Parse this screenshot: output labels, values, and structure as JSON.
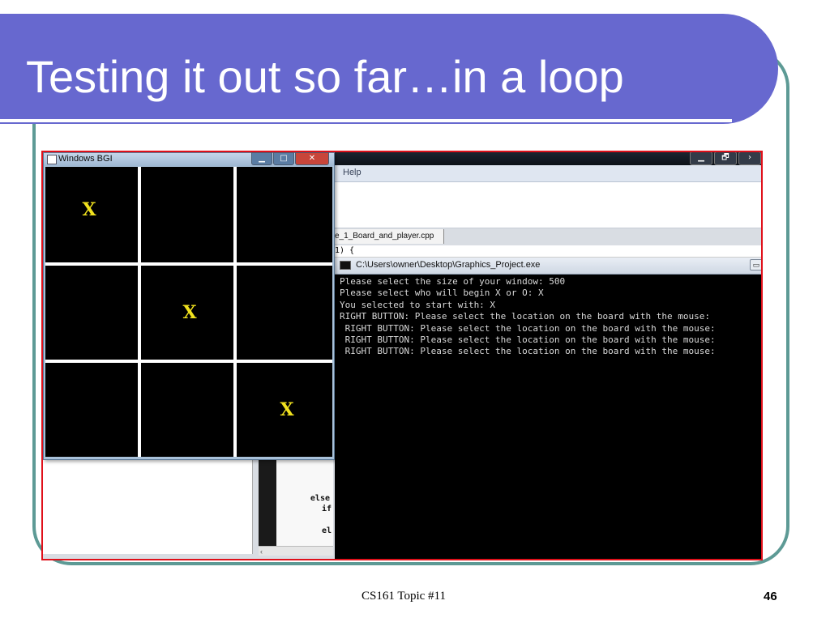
{
  "slide": {
    "title": "Testing it out so far…in a loop",
    "footer": "CS161 Topic #11",
    "page_number": "46"
  },
  "ide": {
    "menu_help": "Help",
    "tab_file": "e_1_Board_and_player.cpp",
    "code_top": "1)  {",
    "code_lines": [
      "else",
      "if",
      "el"
    ],
    "scroll_arrow": "‹",
    "window_controls": [
      "▁",
      "🗗",
      "›"
    ]
  },
  "console": {
    "title": "C:\\Users\\owner\\Desktop\\Graphics_Project.exe",
    "minimize": "▭",
    "lines": [
      "Please select the size of your window: 500",
      "Please select who will begin X or O: X",
      "You selected to start with: X",
      "RIGHT BUTTON: Please select the location on the board with the mouse:",
      " RIGHT BUTTON: Please select the location on the board with the mouse:",
      " RIGHT BUTTON: Please select the location on the board with the mouse:",
      " RIGHT BUTTON: Please select the location on the board with the mouse:"
    ]
  },
  "bgi_window": {
    "title": "Windows BGI",
    "controls": {
      "minimize": "▁",
      "maximize": "□",
      "close": "✕"
    },
    "board": [
      [
        "X",
        "",
        ""
      ],
      [
        "",
        "X",
        ""
      ],
      [
        "",
        "",
        "X"
      ]
    ],
    "mark_color": "#f0e11e"
  },
  "colors": {
    "title_bar": "#6768cf",
    "frame": "#5d9a95",
    "highlight_border": "#e0101a"
  }
}
